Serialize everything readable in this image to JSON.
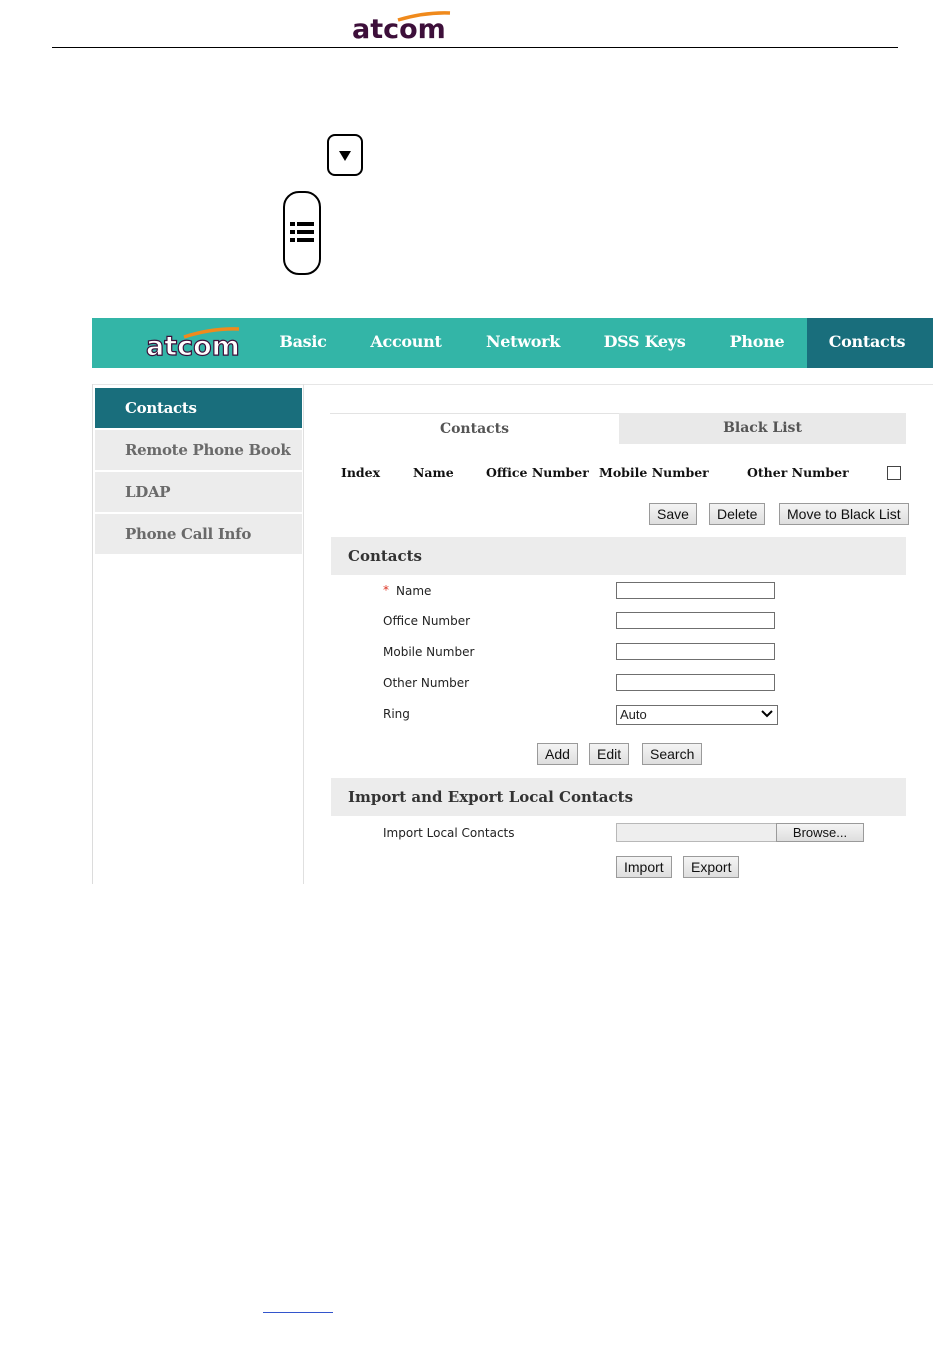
{
  "document": {
    "brand_logo": "atcom"
  },
  "keys": {
    "down_key_icon": "down-arrow-key-icon",
    "menu_key_icon": "menu-list-key-icon"
  },
  "nav": {
    "logo": "atcom",
    "tabs": [
      {
        "label": "Basic",
        "active": false
      },
      {
        "label": "Account",
        "active": false
      },
      {
        "label": "Network",
        "active": false
      },
      {
        "label": "DSS Keys",
        "active": false
      },
      {
        "label": "Phone",
        "active": false
      },
      {
        "label": "Contacts",
        "active": true
      }
    ]
  },
  "sidebar": {
    "items": [
      {
        "label": "Contacts",
        "active": true
      },
      {
        "label": "Remote Phone Book",
        "active": false
      },
      {
        "label": "LDAP",
        "active": false
      },
      {
        "label": "Phone Call Info",
        "active": false
      }
    ]
  },
  "subtabs": {
    "contacts": "Contacts",
    "black_list": "Black List"
  },
  "table": {
    "columns": [
      "Index",
      "Name",
      "Office Number",
      "Mobile Number",
      "Other Number"
    ]
  },
  "table_actions": {
    "save": "Save",
    "delete": "Delete",
    "move_to_black_list": "Move to Black List"
  },
  "contact_form": {
    "title": "Contacts",
    "required_mark": "*",
    "name_label": "Name",
    "office_label": "Office Number",
    "mobile_label": "Mobile Number",
    "other_label": "Other Number",
    "ring_label": "Ring",
    "ring_value": "Auto",
    "add": "Add",
    "edit": "Edit",
    "search": "Search"
  },
  "import_export": {
    "title": "Import and Export Local Contacts",
    "import_label": "Import Local Contacts",
    "browse": "Browse...",
    "import": "Import",
    "export": "Export"
  },
  "colors": {
    "nav_bg": "#33b5a7",
    "active_bg": "#196e7c",
    "logo_orange": "#f08a1c",
    "logo_purple": "#3d0f3a"
  }
}
